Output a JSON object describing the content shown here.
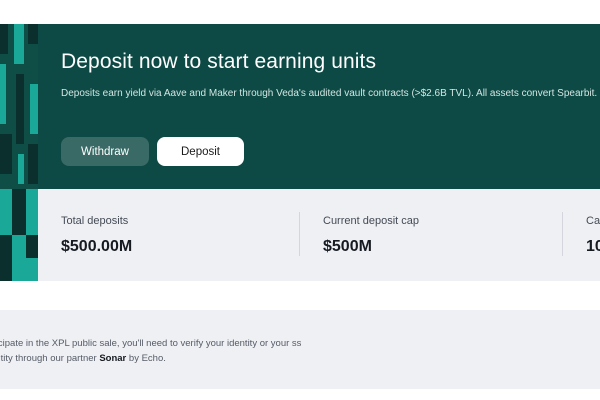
{
  "hero": {
    "title": "Deposit now to start earning units",
    "description": "Deposits earn yield via Aave and Maker through Veda's audited vault contracts (>$2.6B TVL). All assets convert Spearbit.",
    "buttons": {
      "withdraw": "Withdraw",
      "deposit": "Deposit"
    }
  },
  "stats": [
    {
      "label": "Total deposits",
      "value": "$500.00M"
    },
    {
      "label": "Current deposit cap",
      "value": "$500M"
    },
    {
      "label": "Ca",
      "value": "10"
    }
  ],
  "notice": {
    "text_before": "rticipate in the XPL public sale, you'll need to verify your identity or your ss entity through our partner ",
    "partner": "Sonar",
    "text_after": " by Echo."
  },
  "colors": {
    "hero_bg": "#0e4a45",
    "accent_teal": "#1aa898",
    "stats_bg": "#eff0f4"
  }
}
